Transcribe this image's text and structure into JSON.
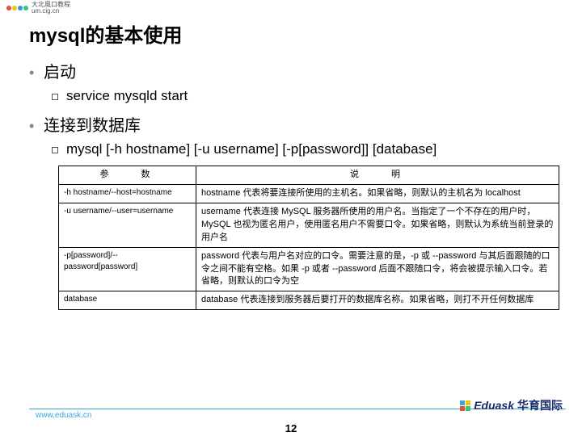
{
  "topLogo": {
    "line1": "大北風口教程",
    "line2": "um.cig.cn"
  },
  "title": "mysql的基本使用",
  "sections": [
    {
      "heading": "启动",
      "items": [
        "service   mysqld     start"
      ]
    },
    {
      "heading": "连接到数据库",
      "items": [
        "mysql  [-h hostname] [-u username] [-p[password]] [database]"
      ]
    }
  ],
  "table": {
    "headers": [
      "参　　数",
      "说　　明"
    ],
    "rows": [
      [
        "-h hostname/--host=hostname",
        "hostname 代表将要连接所使用的主机名。如果省略，则默认的主机名为 localhost"
      ],
      [
        "-u username/--user=username",
        "username 代表连接 MySQL 服务器所使用的用户名。当指定了一个不存在的用户时，MySQL 也视为匿名用户，使用匿名用户不需要口令。如果省略，则默认为系统当前登录的用户名"
      ],
      [
        "-p[password]/--password[password]",
        "password 代表与用户名对应的口令。需要注意的是，-p 或 --password 与其后面跟随的口令之间不能有空格。如果 -p 或者 --password 后面不跟随口令，将会被提示输入口令。若省略，则默认的口令为空"
      ],
      [
        "database",
        "database 代表连接到服务器后要打开的数据库名称。如果省略，则打不开任何数据库"
      ]
    ]
  },
  "footer": {
    "url": "www.eduask.cn",
    "brand1": "Eduask",
    "brand2": "华育国际"
  },
  "pageNumber": "12"
}
